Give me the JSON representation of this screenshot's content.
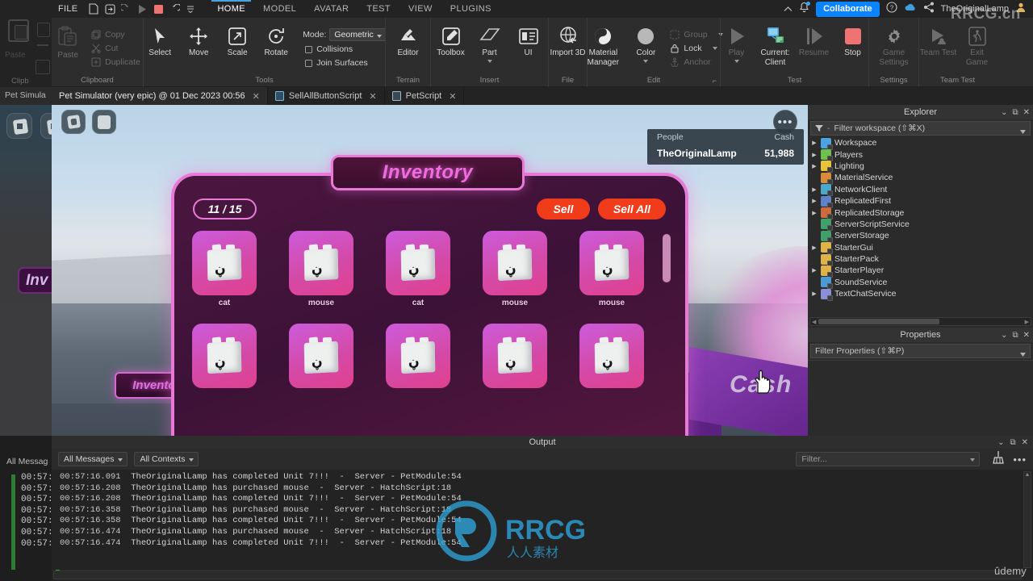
{
  "background_window": {
    "clipboard_label": "Paste",
    "group_label": "Clipb",
    "tab_label": "Pet Simula",
    "world_sign": "Inv",
    "output_filter": "All Messag",
    "log_times": [
      "00:57:",
      "00:57:",
      "00:57:",
      "00:57:",
      "00:57:",
      "00:57:",
      "00:57:"
    ]
  },
  "menubar": {
    "file_label": "FILE",
    "quick_access": [
      "new-file-icon",
      "open-file-icon",
      "redo-icon",
      "play-icon",
      "stop-icon",
      "undo-icon",
      "more-icon"
    ],
    "tabs": [
      {
        "label": "HOME",
        "active": true
      },
      {
        "label": "MODEL",
        "active": false
      },
      {
        "label": "AVATAR",
        "active": false
      },
      {
        "label": "TEST",
        "active": false
      },
      {
        "label": "VIEW",
        "active": false
      },
      {
        "label": "PLUGINS",
        "active": false
      }
    ],
    "collaborate_label": "Collaborate",
    "user_name": "TheOriginalLamp",
    "help_icon": "question-mark-icon",
    "cloud_icon": "cloud-icon",
    "share_icon": "share-icon",
    "bell_icon": "notification-bell-icon"
  },
  "ribbon": {
    "groups": [
      {
        "name": "Clipboard",
        "label": "Clipboard",
        "paste": "Paste",
        "items": [
          "Copy",
          "Cut",
          "Duplicate"
        ]
      },
      {
        "name": "Tools",
        "label": "Tools",
        "buttons": [
          "Select",
          "Move",
          "Scale",
          "Rotate"
        ],
        "mode_label": "Mode:",
        "mode_value": "Geometric",
        "checkboxes": [
          "Collisions",
          "Join Surfaces"
        ]
      },
      {
        "name": "Terrain",
        "label": "Terrain",
        "buttons": [
          "Editor"
        ]
      },
      {
        "name": "Insert",
        "label": "Insert",
        "buttons": [
          "Toolbox",
          "Part",
          "UI"
        ]
      },
      {
        "name": "File",
        "label": "File",
        "buttons": [
          "Import 3D"
        ]
      },
      {
        "name": "Edit",
        "label": "Edit",
        "buttons": [
          "Material Manager",
          "Color"
        ],
        "items": [
          "Group",
          "Lock",
          "Anchor"
        ]
      },
      {
        "name": "Test",
        "label": "Test",
        "buttons": [
          "Play",
          "Current: Client",
          "Resume",
          "Stop"
        ]
      },
      {
        "name": "Settings",
        "label": "Settings",
        "buttons": [
          "Game Settings"
        ]
      },
      {
        "name": "TeamTest",
        "label": "Team Test",
        "buttons": [
          "Team Test",
          "Exit Game"
        ]
      }
    ]
  },
  "doc_tabs": [
    {
      "label": "Pet Simulator (very epic) @ 01 Dec 2023 00:56",
      "active": true,
      "icon": "none"
    },
    {
      "label": "SellAllButtonScript",
      "active": false,
      "icon": "local-script-icon"
    },
    {
      "label": "PetScript",
      "active": false,
      "icon": "script-icon"
    }
  ],
  "viewport": {
    "toolbar_buttons": [
      "roblox-logo-button",
      "menu-button"
    ],
    "more_button": "•••",
    "leaderboard": {
      "columns": [
        "People",
        "Cash"
      ],
      "rows": [
        {
          "name": "TheOriginalLamp",
          "cash": "51,988"
        }
      ]
    },
    "world_sign_label": "Inventory",
    "cash_platform_label": "Cash",
    "inventory": {
      "title": "Inventory",
      "count": "11 / 15",
      "sell_label": "Sell",
      "sell_all_label": "Sell All",
      "slots": [
        {
          "name": "cat"
        },
        {
          "name": "mouse"
        },
        {
          "name": "cat"
        },
        {
          "name": "mouse"
        },
        {
          "name": "mouse"
        },
        {
          "name": ""
        },
        {
          "name": ""
        },
        {
          "name": ""
        },
        {
          "name": ""
        },
        {
          "name": ""
        }
      ]
    }
  },
  "explorer": {
    "title": "Explorer",
    "filter_placeholder": "Filter workspace (⇧⌘X)",
    "items": [
      {
        "label": "Workspace",
        "expandable": true,
        "color": "#4ba3e3",
        "icon": "workspace-icon"
      },
      {
        "label": "Players",
        "expandable": true,
        "color": "#6cc24a",
        "icon": "players-icon"
      },
      {
        "label": "Lighting",
        "expandable": true,
        "color": "#e8c33a",
        "icon": "lighting-icon"
      },
      {
        "label": "MaterialService",
        "expandable": false,
        "color": "#d98a3a",
        "icon": "material-service-icon"
      },
      {
        "label": "NetworkClient",
        "expandable": true,
        "color": "#4aa8c8",
        "icon": "network-client-icon"
      },
      {
        "label": "ReplicatedFirst",
        "expandable": true,
        "color": "#5d82c9",
        "icon": "replicated-first-icon"
      },
      {
        "label": "ReplicatedStorage",
        "expandable": true,
        "color": "#cf6a3d",
        "icon": "replicated-storage-icon"
      },
      {
        "label": "ServerScriptService",
        "expandable": false,
        "color": "#3fa06a",
        "icon": "server-script-service-icon"
      },
      {
        "label": "ServerStorage",
        "expandable": false,
        "color": "#3fa06a",
        "icon": "server-storage-icon"
      },
      {
        "label": "StarterGui",
        "expandable": true,
        "color": "#e0b348",
        "icon": "starter-gui-icon"
      },
      {
        "label": "StarterPack",
        "expandable": false,
        "color": "#e0b348",
        "icon": "starter-pack-icon"
      },
      {
        "label": "StarterPlayer",
        "expandable": true,
        "color": "#e0b348",
        "icon": "starter-player-icon"
      },
      {
        "label": "SoundService",
        "expandable": false,
        "color": "#4a9ad6",
        "icon": "sound-service-icon"
      },
      {
        "label": "TextChatService",
        "expandable": true,
        "color": "#8a8fd8",
        "icon": "text-chat-service-icon"
      }
    ]
  },
  "properties": {
    "title": "Properties",
    "filter_placeholder": "Filter Properties (⇧⌘P)"
  },
  "output": {
    "title": "Output",
    "messages_filter": "All Messages",
    "contexts_filter": "All Contexts",
    "search_placeholder": "Filter...",
    "clear_icon": "broom-icon",
    "more_icon": "ellipsis-icon",
    "lines": [
      {
        "time": "00:57:16.091",
        "text": "TheOriginalLamp has completed Unit 7!!!  -  Server - PetModule:54"
      },
      {
        "time": "00:57:16.208",
        "text": "TheOriginalLamp has purchased mouse  -  Server - HatchScript:18"
      },
      {
        "time": "00:57:16.208",
        "text": "TheOriginalLamp has completed Unit 7!!!  -  Server - PetModule:54"
      },
      {
        "time": "00:57:16.358",
        "text": "TheOriginalLamp has purchased mouse  -  Server - HatchScript:18"
      },
      {
        "time": "00:57:16.358",
        "text": "TheOriginalLamp has completed Unit 7!!!  -  Server - PetModule:54"
      },
      {
        "time": "00:57:16.474",
        "text": "TheOriginalLamp has purchased mouse  -  Server - HatchScript:18"
      },
      {
        "time": "00:57:16.474",
        "text": "TheOriginalLamp has completed Unit 7!!!  -  Server - PetModule:54"
      }
    ]
  },
  "watermarks": {
    "top_right": "RRCG.cn",
    "center_main": "RRCG",
    "center_sub": "人人素材",
    "bottom_right": "ûdemy",
    "viewport_faint": "RRCG",
    "viewport_faint_sub": "人人素材"
  },
  "colors": {
    "accent_blue": "#0a84ff",
    "tab_underline": "#4aa3e0",
    "stop_red": "#f07373",
    "inventory_pink": "#e879d6",
    "sell_red": "#f13c1b",
    "log_green": "#2f9e3f"
  }
}
